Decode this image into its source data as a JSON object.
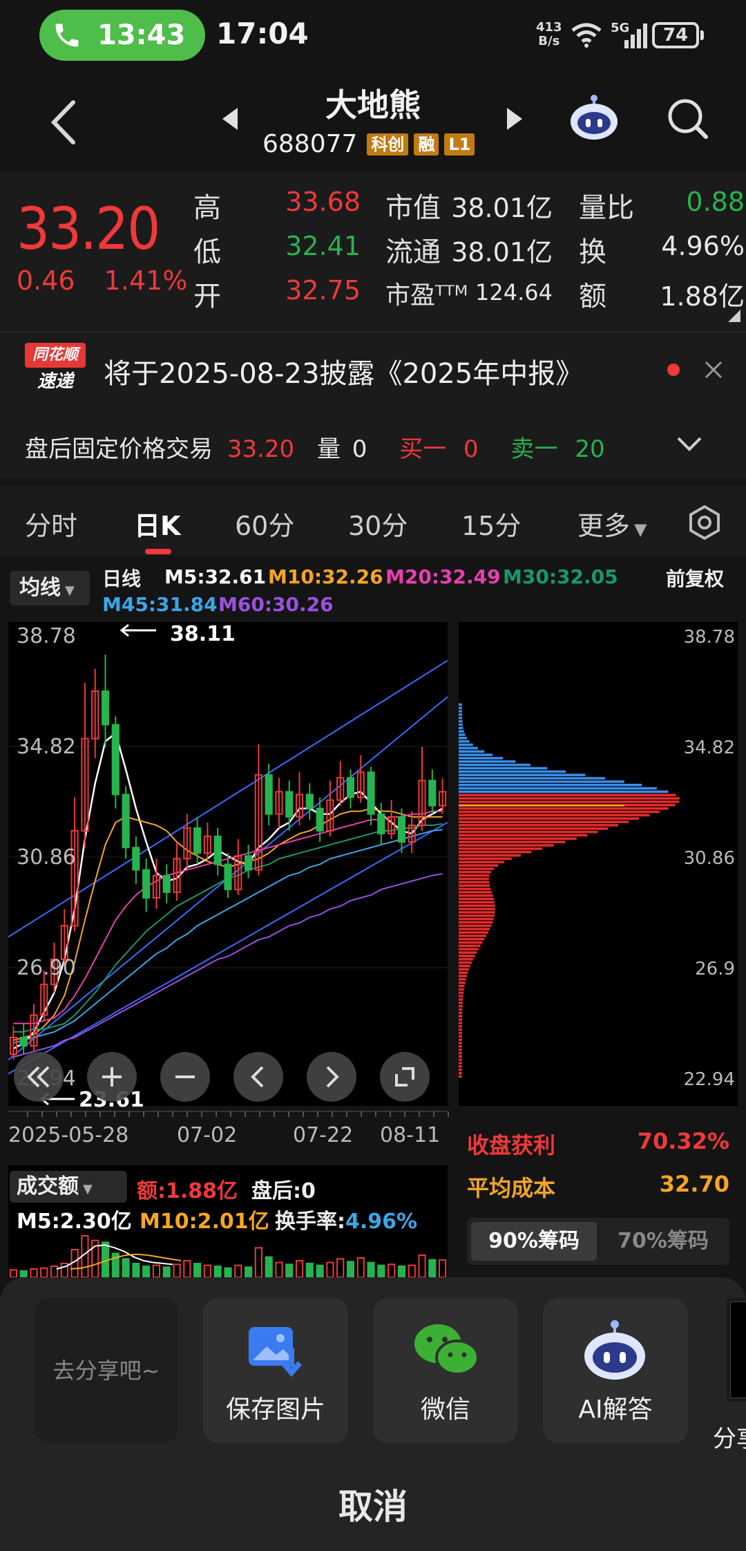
{
  "status_bar": {
    "call_time": "13:43",
    "clock": "17:04",
    "net_speed_value": "413",
    "net_speed_unit": "B/s",
    "network": "5G",
    "battery": "74"
  },
  "header": {
    "stock_name": "大地熊",
    "stock_code": "688077",
    "tags": [
      "科创",
      "融",
      "L1"
    ]
  },
  "quote": {
    "last_price": "33.20",
    "change": "0.46",
    "change_pct": "1.41%",
    "high_label": "高",
    "high": "33.68",
    "low_label": "低",
    "low": "32.41",
    "open_label": "开",
    "open": "32.75",
    "mktcap_label": "市值",
    "mktcap": "38.01亿",
    "float_label": "流通",
    "float": "38.01亿",
    "pe_label": "市盈ᵀᵀᴹ",
    "pe": "124.64",
    "vol_ratio_label": "量比",
    "vol_ratio": "0.88",
    "turnover_label": "换",
    "turnover": "4.96%",
    "amount_label": "额",
    "amount": "1.88亿"
  },
  "notice": {
    "logo_line1": "同花顺",
    "logo_line2": "速递",
    "text": "将于2025-08-23披露《2025年中报》"
  },
  "after_hours": {
    "label": "盘后固定价格交易",
    "price": "33.20",
    "vol_label": "量",
    "vol": "0",
    "buy1_label": "买一",
    "buy1": "0",
    "sell1_label": "卖一",
    "sell1": "20"
  },
  "tabs": [
    "分时",
    "日K",
    "60分",
    "30分",
    "15分",
    "更多"
  ],
  "active_tab": "日K",
  "ma_header": {
    "select_label": "均线",
    "period": "日线",
    "m5": "M5:32.61",
    "m10": "M10:32.26",
    "m20": "M20:32.49",
    "m30": "M30:32.05",
    "m45": "M45:31.84",
    "m60": "M60:30.26",
    "adjust": "前复权"
  },
  "colors": {
    "up": "#f0393a",
    "down": "#27b34f",
    "m5": "#ffffff",
    "m10": "#f5a623",
    "m20": "#e83fb0",
    "m30": "#159a6b",
    "m45": "#3aa6e8",
    "m60": "#9b51e0"
  },
  "chart_data": {
    "type": "candlestick",
    "y_ticks": [
      "38.78",
      "34.82",
      "30.86",
      "26.90",
      "22.94"
    ],
    "x_ticks": [
      "2025-05-28",
      "07-02",
      "07-22",
      "08-11"
    ],
    "ylim": [
      22.94,
      38.78
    ],
    "max_marker": "38.11",
    "min_marker": "23.61",
    "chip_y_ticks": [
      "38.78",
      "34.82",
      "30.86",
      "26.9",
      "22.94"
    ],
    "candles": [
      {
        "o": 23.8,
        "c": 24.4,
        "h": 24.8,
        "l": 23.6
      },
      {
        "o": 24.4,
        "c": 24.1,
        "h": 24.9,
        "l": 23.8
      },
      {
        "o": 24.1,
        "c": 25.2,
        "h": 25.6,
        "l": 23.9
      },
      {
        "o": 25.2,
        "c": 26.3,
        "h": 26.8,
        "l": 25.0
      },
      {
        "o": 26.3,
        "c": 27.2,
        "h": 27.8,
        "l": 26.0
      },
      {
        "o": 27.2,
        "c": 28.4,
        "h": 29.0,
        "l": 27.0
      },
      {
        "o": 28.4,
        "c": 31.8,
        "h": 33.0,
        "l": 28.2
      },
      {
        "o": 31.8,
        "c": 35.1,
        "h": 37.1,
        "l": 31.2
      },
      {
        "o": 35.1,
        "c": 36.8,
        "h": 37.6,
        "l": 34.4
      },
      {
        "o": 36.8,
        "c": 35.6,
        "h": 38.11,
        "l": 34.8
      },
      {
        "o": 35.6,
        "c": 33.1,
        "h": 35.9,
        "l": 32.6
      },
      {
        "o": 33.1,
        "c": 31.2,
        "h": 33.4,
        "l": 30.8
      },
      {
        "o": 31.2,
        "c": 30.4,
        "h": 31.6,
        "l": 29.9
      },
      {
        "o": 30.4,
        "c": 29.4,
        "h": 30.8,
        "l": 28.9
      },
      {
        "o": 29.4,
        "c": 30.2,
        "h": 30.8,
        "l": 29.0
      },
      {
        "o": 30.2,
        "c": 29.6,
        "h": 30.6,
        "l": 29.2
      },
      {
        "o": 29.6,
        "c": 30.8,
        "h": 31.4,
        "l": 29.3
      },
      {
        "o": 30.8,
        "c": 31.9,
        "h": 32.4,
        "l": 30.4
      },
      {
        "o": 31.9,
        "c": 31.0,
        "h": 32.3,
        "l": 30.6
      },
      {
        "o": 31.0,
        "c": 31.6,
        "h": 32.1,
        "l": 30.7
      },
      {
        "o": 31.6,
        "c": 30.6,
        "h": 31.9,
        "l": 30.2
      },
      {
        "o": 30.6,
        "c": 29.7,
        "h": 31.0,
        "l": 29.4
      },
      {
        "o": 29.7,
        "c": 30.9,
        "h": 31.5,
        "l": 29.5
      },
      {
        "o": 30.9,
        "c": 30.4,
        "h": 31.3,
        "l": 30.1
      },
      {
        "o": 30.4,
        "c": 33.8,
        "h": 34.9,
        "l": 30.2
      },
      {
        "o": 33.8,
        "c": 32.4,
        "h": 34.2,
        "l": 32.0
      },
      {
        "o": 32.4,
        "c": 33.2,
        "h": 33.7,
        "l": 31.9
      },
      {
        "o": 33.2,
        "c": 32.3,
        "h": 33.6,
        "l": 31.8
      },
      {
        "o": 32.3,
        "c": 33.1,
        "h": 33.9,
        "l": 32.0
      },
      {
        "o": 33.1,
        "c": 32.6,
        "h": 33.5,
        "l": 32.2
      },
      {
        "o": 32.6,
        "c": 31.8,
        "h": 33.0,
        "l": 31.4
      },
      {
        "o": 31.8,
        "c": 32.9,
        "h": 33.6,
        "l": 31.6
      },
      {
        "o": 32.9,
        "c": 33.7,
        "h": 34.3,
        "l": 32.7
      },
      {
        "o": 33.7,
        "c": 33.0,
        "h": 34.0,
        "l": 32.6
      },
      {
        "o": 33.0,
        "c": 33.9,
        "h": 34.5,
        "l": 32.8
      },
      {
        "o": 33.9,
        "c": 32.4,
        "h": 34.1,
        "l": 32.0
      },
      {
        "o": 32.4,
        "c": 31.7,
        "h": 32.8,
        "l": 31.3
      },
      {
        "o": 31.7,
        "c": 32.3,
        "h": 32.9,
        "l": 31.5
      },
      {
        "o": 32.3,
        "c": 31.4,
        "h": 32.6,
        "l": 31.0
      },
      {
        "o": 31.4,
        "c": 32.0,
        "h": 32.5,
        "l": 31.0
      },
      {
        "o": 32.0,
        "c": 33.6,
        "h": 34.8,
        "l": 31.8
      },
      {
        "o": 33.6,
        "c": 32.7,
        "h": 34.0,
        "l": 32.4
      },
      {
        "o": 32.7,
        "c": 33.2,
        "h": 33.68,
        "l": 32.41
      }
    ],
    "ma_lines": {
      "m5": [
        24.0,
        24.2,
        24.6,
        25.3,
        26.0,
        27.2,
        29.0,
        31.5,
        33.5,
        35.0,
        35.3,
        34.0,
        32.6,
        31.4,
        30.3,
        30.0,
        30.1,
        30.5,
        30.6,
        30.8,
        31.1,
        30.9,
        30.7,
        30.6,
        31.2,
        31.5,
        31.9,
        32.1,
        32.6,
        32.6,
        32.4,
        32.4,
        32.8,
        33.1,
        33.2,
        32.8,
        32.4,
        32.1,
        31.8,
        31.7,
        32.2,
        32.4,
        32.6
      ],
      "m10": [
        24.3,
        24.4,
        24.5,
        24.8,
        25.2,
        25.9,
        27.1,
        28.6,
        30.0,
        31.3,
        32.1,
        32.3,
        32.2,
        32.1,
        32.0,
        31.8,
        31.4,
        31.1,
        30.9,
        30.7,
        30.6,
        30.5,
        30.6,
        30.7,
        30.8,
        31.0,
        31.3,
        31.5,
        31.7,
        31.8,
        32.0,
        32.2,
        32.4,
        32.5,
        32.5,
        32.6,
        32.5,
        32.5,
        32.4,
        32.3,
        32.3,
        32.3,
        32.3
      ],
      "m20": [
        24.9,
        24.9,
        24.9,
        25.0,
        25.1,
        25.4,
        25.9,
        26.5,
        27.2,
        27.9,
        28.6,
        29.1,
        29.5,
        29.8,
        30.0,
        30.2,
        30.3,
        30.4,
        30.5,
        30.6,
        30.7,
        30.8,
        30.9,
        31.0,
        31.1,
        31.2,
        31.3,
        31.4,
        31.5,
        31.6,
        31.7,
        31.8,
        31.9,
        32.0,
        32.1,
        32.2,
        32.2,
        32.3,
        32.3,
        32.4,
        32.4,
        32.5,
        32.5
      ],
      "m30": [
        24.6,
        24.6,
        24.7,
        24.7,
        24.8,
        24.9,
        25.2,
        25.6,
        26.0,
        26.5,
        27.0,
        27.4,
        27.8,
        28.2,
        28.5,
        28.8,
        29.1,
        29.3,
        29.5,
        29.7,
        29.9,
        30.1,
        30.2,
        30.4,
        30.5,
        30.6,
        30.8,
        30.9,
        31.0,
        31.1,
        31.2,
        31.3,
        31.4,
        31.5,
        31.6,
        31.7,
        31.8,
        31.8,
        31.9,
        31.9,
        32.0,
        32.0,
        32.05
      ],
      "m45": [
        24.2,
        24.3,
        24.4,
        24.5,
        24.6,
        24.8,
        25.0,
        25.3,
        25.6,
        25.9,
        26.2,
        26.5,
        26.8,
        27.1,
        27.4,
        27.6,
        27.9,
        28.1,
        28.4,
        28.6,
        28.8,
        29.0,
        29.2,
        29.4,
        29.6,
        29.8,
        30.0,
        30.2,
        30.3,
        30.5,
        30.6,
        30.8,
        30.9,
        31.0,
        31.1,
        31.2,
        31.3,
        31.4,
        31.5,
        31.6,
        31.7,
        31.8,
        31.84
      ],
      "m60": [
        23.7,
        23.8,
        23.9,
        24.0,
        24.1,
        24.3,
        24.4,
        24.6,
        24.8,
        25.0,
        25.2,
        25.4,
        25.6,
        25.8,
        26.0,
        26.2,
        26.4,
        26.6,
        26.8,
        27.0,
        27.2,
        27.3,
        27.5,
        27.7,
        27.9,
        28.0,
        28.2,
        28.4,
        28.5,
        28.7,
        28.8,
        29.0,
        29.1,
        29.3,
        29.4,
        29.5,
        29.7,
        29.8,
        29.9,
        30.0,
        30.1,
        30.2,
        30.26
      ]
    },
    "volume": [
      0.8,
      0.7,
      0.9,
      1.0,
      1.2,
      1.5,
      3.0,
      4.5,
      4.0,
      3.8,
      2.6,
      2.0,
      1.5,
      1.2,
      1.3,
      1.1,
      1.4,
      1.8,
      1.5,
      1.3,
      1.2,
      1.0,
      1.3,
      1.1,
      3.2,
      2.2,
      1.6,
      1.4,
      1.8,
      1.5,
      1.3,
      1.6,
      2.0,
      1.7,
      2.1,
      1.6,
      1.3,
      1.4,
      1.2,
      1.3,
      2.4,
      1.9,
      1.88
    ]
  },
  "chip": {
    "profit_label": "收盘获利",
    "profit": "70.32%",
    "avg_cost_label": "平均成本",
    "avg_cost": "32.70",
    "tab_90": "90%筹码",
    "tab_70": "70%筹码"
  },
  "volume_header": {
    "select_label": "成交额",
    "amount": "额:1.88亿",
    "after": "盘后:0",
    "m5": "M5:2.30亿",
    "m10": "M10:2.01亿",
    "turnover_label": "换手率:",
    "turnover": "4.96%"
  },
  "share_sheet": {
    "go_share": "去分享吧~",
    "save_image": "保存图片",
    "wechat": "微信",
    "ai_answer": "AI解答",
    "share_more": "分享",
    "cancel": "取消"
  }
}
